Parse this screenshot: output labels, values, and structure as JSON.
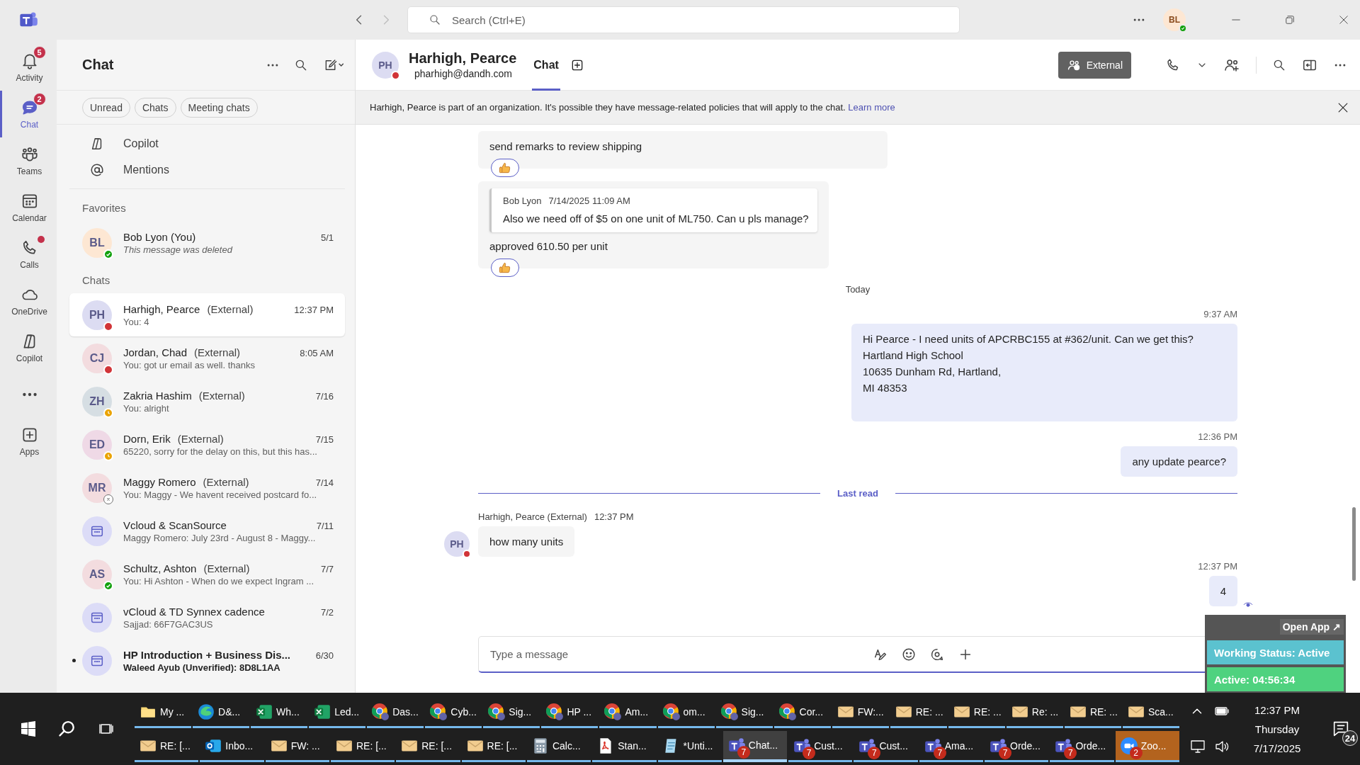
{
  "title_bar": {
    "search_placeholder": "Search (Ctrl+E)",
    "avatar": "BL",
    "presence": {
      "kind": "available",
      "color": "#13a10e"
    }
  },
  "rail": [
    {
      "kind": "activity",
      "label": "Activity",
      "badge": "5",
      "dot": false,
      "selected": false
    },
    {
      "kind": "chat",
      "label": "Chat",
      "badge": "2",
      "dot": false,
      "selected": true
    },
    {
      "kind": "teams",
      "label": "Teams",
      "dot": false,
      "selected": false
    },
    {
      "kind": "calendar",
      "label": "Calendar",
      "dot": false,
      "selected": false
    },
    {
      "kind": "calls",
      "label": "Calls",
      "dot": true,
      "selected": false
    },
    {
      "kind": "onedrive",
      "label": "OneDrive",
      "dot": false,
      "selected": false
    },
    {
      "kind": "copilot",
      "label": "Copilot",
      "dot": false,
      "selected": false
    },
    {
      "kind": "more",
      "dot": false,
      "selected": false
    },
    {
      "kind": "apps",
      "label": "Apps",
      "dot": false,
      "selected": false
    }
  ],
  "chat_panel": {
    "title": "Chat",
    "filters": [
      {
        "label": "Unread",
        "selected": false
      },
      {
        "label": "Chats",
        "selected": false
      },
      {
        "label": "Meeting chats",
        "selected": false
      }
    ],
    "pinned": [
      {
        "kind": "copilot",
        "label": "Copilot"
      },
      {
        "kind": "mentions",
        "label": "Mentions"
      }
    ],
    "favorites": {
      "heading": "Favorites",
      "items": [
        {
          "kind": "person",
          "initials": "BL",
          "color": "#fde7d3",
          "name": "Bob Lyon (You)",
          "preview": "This message was deleted",
          "preview_italic": true,
          "time": "5/1",
          "presence": {
            "kind": "available",
            "color": "#13a10e"
          },
          "selected": false,
          "unread": false
        }
      ]
    },
    "chats": {
      "heading": "Chats",
      "items": [
        {
          "kind": "person",
          "initials": "PH",
          "color": "#dcdcf2",
          "name": "Harhigh, Pearce",
          "tag": "(External)",
          "preview": "You: 4",
          "preview_italic": false,
          "time": "12:37 PM",
          "presence": {
            "kind": "busy",
            "color": "#d13438"
          },
          "selected": true,
          "unread": false
        },
        {
          "kind": "person",
          "initials": "CJ",
          "color": "#f3dcdf",
          "name": "Jordan, Chad",
          "tag": "(External)",
          "preview": "You: got ur email as well. thanks",
          "preview_italic": false,
          "time": "8:05 AM",
          "presence": {
            "kind": "busy",
            "color": "#d13438"
          },
          "selected": false,
          "unread": false
        },
        {
          "kind": "person",
          "initials": "ZH",
          "color": "#d6dee3",
          "name": "Zakria Hashim",
          "tag": "(External)",
          "preview": "You: alright",
          "preview_italic": false,
          "time": "7/16",
          "presence": {
            "kind": "away",
            "color": "#eaa300"
          },
          "selected": false,
          "unread": false
        },
        {
          "kind": "person",
          "initials": "ED",
          "color": "#efd9e6",
          "name": "Dorn, Erik",
          "tag": "(External)",
          "preview": "65220, sorry for the delay on this, but this has...",
          "preview_italic": false,
          "time": "7/15",
          "presence": {
            "kind": "away",
            "color": "#eaa300"
          },
          "selected": false,
          "unread": false
        },
        {
          "kind": "person",
          "initials": "MR",
          "color": "#f3dcdf",
          "name": "Maggy Romero",
          "tag": "(External)",
          "preview": "You: Maggy - We havent received postcard fo...",
          "preview_italic": false,
          "time": "7/14",
          "presence": {
            "kind": "offline",
            "color": "#ffffff"
          },
          "selected": false,
          "unread": false
        },
        {
          "kind": "meeting",
          "name": "Vcloud & ScanSource",
          "preview": "Maggy Romero: July 23rd - August 8 - Maggy...",
          "preview_italic": false,
          "time": "7/11",
          "selected": false,
          "unread": false
        },
        {
          "kind": "person",
          "initials": "AS",
          "color": "#f3dcdf",
          "name": "Schultz, Ashton",
          "tag": "(External)",
          "preview": "You: Hi Ashton -  When do we expect Ingram ...",
          "preview_italic": false,
          "time": "7/7",
          "presence": {
            "kind": "available",
            "color": "#13a10e"
          },
          "selected": false,
          "unread": false
        },
        {
          "kind": "meeting",
          "name": "vCloud & TD Synnex cadence",
          "preview": "Sajjad: 66F7GAC3US",
          "preview_italic": false,
          "time": "7/2",
          "selected": false,
          "unread": false
        },
        {
          "kind": "meeting",
          "name": "HP Introduction + Business Dis...",
          "preview": "Waleed Ayub (Unverified): 8D8L1AA",
          "preview_italic": false,
          "time": "6/30",
          "selected": false,
          "unread": true
        }
      ]
    }
  },
  "conversation": {
    "header": {
      "initials": "PH",
      "presence": {
        "kind": "busy",
        "color": "#d13438"
      },
      "name": "Harhigh, Pearce",
      "email": "pharhigh@dandh.com",
      "tabs": [
        {
          "label": "Chat",
          "selected": true
        }
      ],
      "external_button": "External"
    },
    "banner": {
      "text": "Harhigh, Pearce is part of an organization. It's possible they have message-related policies that will apply to the chat.",
      "link": "Learn more"
    },
    "messages": [
      {
        "kind": "received",
        "text": "send remarks to review shipping",
        "reaction": true
      },
      {
        "kind": "received",
        "quote": {
          "author": "Bob Lyon",
          "time": "7/14/2025 11:09 AM",
          "text": "Also we need off of $5 on one unit of ML750. Can u pls manage?"
        },
        "text": "approved 610.50 per unit",
        "reaction": true
      },
      {
        "kind": "date",
        "text": "Today"
      },
      {
        "kind": "sent",
        "time": "9:37 AM",
        "lines": [
          "Hi Pearce -  I need units of APCRBC155 at #362/unit. Can we get this?",
          "Hartland High School",
          "10635 Dunham Rd, Hartland,",
          "MI 48353"
        ],
        "seen": false
      },
      {
        "kind": "sent",
        "time": "12:36 PM",
        "lines": [
          "any update pearce?"
        ],
        "seen": false
      },
      {
        "kind": "divider",
        "text": "Last read"
      },
      {
        "kind": "received",
        "sender": "Harhigh, Pearce (External)",
        "time": "12:37 PM",
        "initials": "PH",
        "presence": {
          "kind": "busy",
          "color": "#d13438"
        },
        "text": "how many units",
        "reaction": false
      },
      {
        "kind": "sent",
        "time": "12:37 PM",
        "lines": [
          "4"
        ],
        "seen": true
      }
    ],
    "composer": {
      "placeholder": "Type a message"
    }
  },
  "status_widget": {
    "open_app": "Open App ↗",
    "status": "Working Status: Active",
    "timer": "Active: 04:56:34"
  },
  "taskbar": {
    "row_1": [
      {
        "kind": "folder",
        "label": "My ...",
        "selected": false,
        "flashing": false
      },
      {
        "kind": "edge",
        "label": "D&...",
        "selected": false,
        "flashing": false
      },
      {
        "kind": "excel",
        "label": "Wh...",
        "selected": false,
        "flashing": false
      },
      {
        "kind": "excel",
        "label": "Led...",
        "selected": false,
        "flashing": false
      },
      {
        "kind": "chrome",
        "label": "Das...",
        "selected": false,
        "flashing": false
      },
      {
        "kind": "chrome",
        "label": "Cyb...",
        "selected": false,
        "flashing": false
      },
      {
        "kind": "chrome",
        "label": "Sig...",
        "selected": false,
        "flashing": false
      },
      {
        "kind": "chrome",
        "label": "HP ...",
        "selected": false,
        "flashing": false
      },
      {
        "kind": "chrome",
        "label": "Am...",
        "selected": false,
        "flashing": false
      },
      {
        "kind": "chrome",
        "label": "om...",
        "selected": false,
        "flashing": false
      },
      {
        "kind": "chrome",
        "label": "Sig...",
        "selected": false,
        "flashing": false
      },
      {
        "kind": "chrome",
        "label": "Cor...",
        "selected": false,
        "flashing": false
      },
      {
        "kind": "mail",
        "label": "FW:...",
        "selected": false,
        "flashing": false
      },
      {
        "kind": "mail",
        "label": "RE: ...",
        "selected": false,
        "flashing": false
      },
      {
        "kind": "mail",
        "label": "RE: ...",
        "selected": false,
        "flashing": false
      },
      {
        "kind": "mail",
        "label": "Re: ...",
        "selected": false,
        "flashing": false
      },
      {
        "kind": "mail",
        "label": "RE: ...",
        "selected": false,
        "flashing": false
      },
      {
        "kind": "mail",
        "label": "Sca...",
        "selected": false,
        "flashing": false
      }
    ],
    "row_2": [
      {
        "kind": "mail",
        "label": "RE: [...",
        "selected": false,
        "flashing": false
      },
      {
        "kind": "outlook",
        "label": "Inbo...",
        "selected": false,
        "flashing": false
      },
      {
        "kind": "mail",
        "label": "FW: ...",
        "selected": false,
        "flashing": false
      },
      {
        "kind": "mail",
        "label": "RE: [...",
        "selected": false,
        "flashing": false
      },
      {
        "kind": "mail",
        "label": "RE: [...",
        "selected": false,
        "flashing": false
      },
      {
        "kind": "mail",
        "label": "RE: [...",
        "selected": false,
        "flashing": false
      },
      {
        "kind": "calculator",
        "label": "Calc...",
        "selected": false,
        "flashing": false
      },
      {
        "kind": "pdf",
        "label": "Stan...",
        "selected": false,
        "flashing": false
      },
      {
        "kind": "notepad",
        "label": "*Unti...",
        "selected": false,
        "flashing": false
      },
      {
        "kind": "teams",
        "label": "Chat...",
        "badge": "7",
        "selected": true,
        "flashing": false
      },
      {
        "kind": "teams",
        "label": "Cust...",
        "badge": "7",
        "selected": false,
        "flashing": false
      },
      {
        "kind": "teams",
        "label": "Cust...",
        "badge": "7",
        "selected": false,
        "flashing": false
      },
      {
        "kind": "teams",
        "label": "Ama...",
        "badge": "7",
        "selected": false,
        "flashing": false
      },
      {
        "kind": "teams",
        "label": "Orde...",
        "badge": "7",
        "selected": false,
        "flashing": false
      },
      {
        "kind": "teams",
        "label": "Orde...",
        "badge": "7",
        "selected": false,
        "flashing": false
      },
      {
        "kind": "zoom",
        "label": "Zoo...",
        "badge": "2",
        "selected": false,
        "flashing": true
      }
    ],
    "clock": {
      "time": "12:37 PM",
      "day": "Thursday",
      "date": "7/17/2025"
    },
    "notifications": "24"
  }
}
